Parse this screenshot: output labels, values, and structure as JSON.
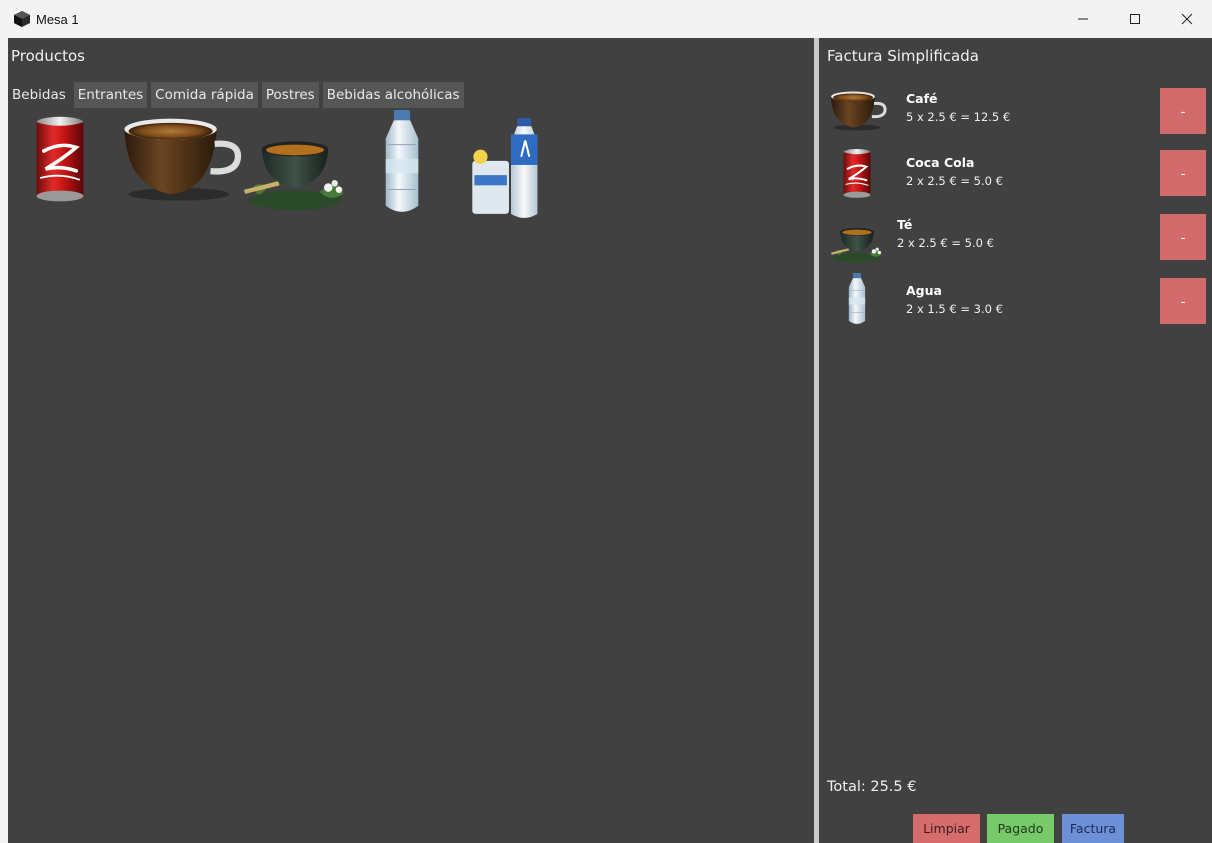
{
  "window": {
    "title": "Mesa 1"
  },
  "products_panel": {
    "title": "Productos",
    "tabs": [
      {
        "label": "Bebidas",
        "active": true
      },
      {
        "label": "Entrantes",
        "active": false
      },
      {
        "label": "Comida rápida",
        "active": false
      },
      {
        "label": "Postres",
        "active": false
      },
      {
        "label": "Bebidas alcohólicas",
        "active": false
      }
    ],
    "items": [
      {
        "icon": "coca-cola-can-icon"
      },
      {
        "icon": "coffee-cup-icon"
      },
      {
        "icon": "tea-bowl-icon"
      },
      {
        "icon": "water-bottle-icon"
      },
      {
        "icon": "aquarius-drink-icon"
      }
    ]
  },
  "invoice_panel": {
    "title": "Factura Simplificada",
    "items": [
      {
        "name": "Café",
        "calc": "5 x 2.5 € = 12.5 €",
        "remove_label": "-",
        "icon": "coffee-cup-icon"
      },
      {
        "name": "Coca Cola",
        "calc": "2 x 2.5 € = 5.0 €",
        "remove_label": "-",
        "icon": "coca-cola-can-icon"
      },
      {
        "name": "Té",
        "calc": "2 x 2.5 € = 5.0 €",
        "remove_label": "-",
        "icon": "tea-bowl-icon"
      },
      {
        "name": "Agua",
        "calc": "2 x 1.5 € = 3.0 €",
        "remove_label": "-",
        "icon": "water-bottle-icon"
      }
    ],
    "total": "Total: 25.5 €",
    "buttons": {
      "clear": "Limpiar",
      "paid": "Pagado",
      "invoice": "Factura"
    }
  },
  "colors": {
    "background": "#414141",
    "remove_button": "#d16b6b",
    "clear_button": "#d76c6c",
    "paid_button": "#78c96a",
    "invoice_button": "#6d8fd6"
  }
}
